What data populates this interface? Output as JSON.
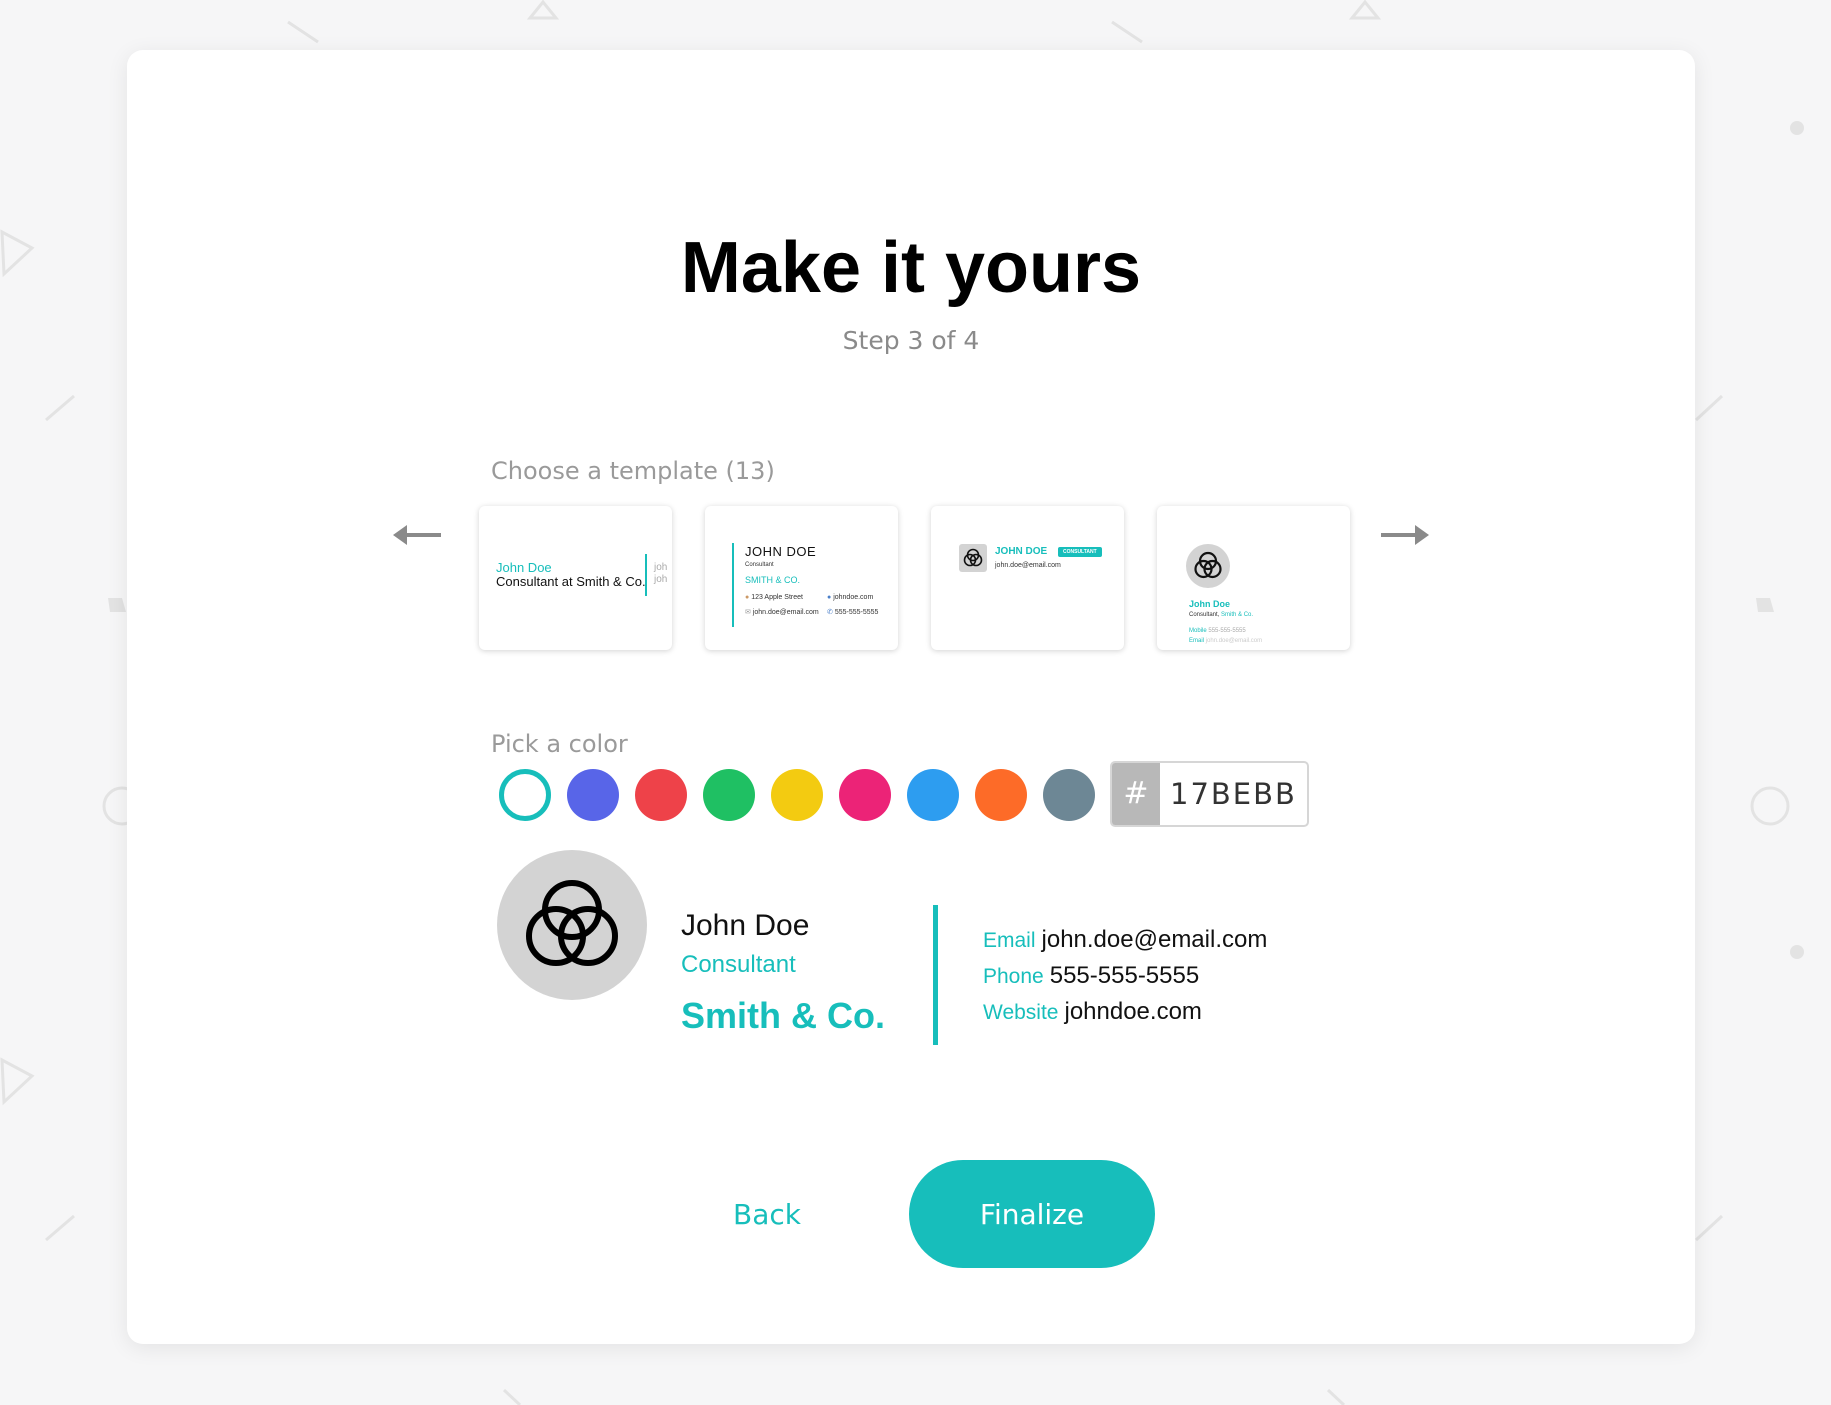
{
  "page": {
    "title": "Make it yours",
    "step": "Step 3 of 4"
  },
  "templates": {
    "label": "Choose a template (13)",
    "prev_icon": "arrow-left-icon",
    "next_icon": "arrow-right-icon",
    "t1": {
      "name": "John Doe",
      "subtitle": "Consultant at Smith & Co.",
      "side1": "joh",
      "side2": "joh"
    },
    "t2": {
      "name": "JOHN DOE",
      "role": "Consultant",
      "company": "SMITH & CO.",
      "address": "123 Apple Street",
      "website": "johndoe.com",
      "email": "john.doe@email.com",
      "phone": "555-555-5555"
    },
    "t3": {
      "name": "JOHN DOE",
      "badge": "CONSULTANT",
      "email": "john.doe@email.com"
    },
    "t4": {
      "name": "John Doe",
      "role_prefix": "Consultant,",
      "company": "Smith & Co.",
      "mobile_label": "Mobile",
      "mobile": "555-555-5555",
      "email_label": "Email",
      "email": "john.doe@email.com"
    }
  },
  "colors": {
    "label": "Pick a color",
    "swatches": [
      "#17bebb",
      "#5865e8",
      "#ee4249",
      "#1fc063",
      "#f3cb11",
      "#ec2377",
      "#2d9df0",
      "#fd6b28",
      "#6d8795"
    ],
    "selected": "#17bebb",
    "hash_symbol": "#",
    "hex_value": "17BEBB"
  },
  "signature": {
    "logo_icon": "three-circles-logo-icon",
    "name": "John Doe",
    "role": "Consultant",
    "company": "Smith & Co.",
    "email_label": "Email",
    "email": "john.doe@email.com",
    "phone_label": "Phone",
    "phone": "555-555-5555",
    "website_label": "Website",
    "website": "johndoe.com"
  },
  "actions": {
    "back_label": "Back",
    "finalize_label": "Finalize"
  }
}
